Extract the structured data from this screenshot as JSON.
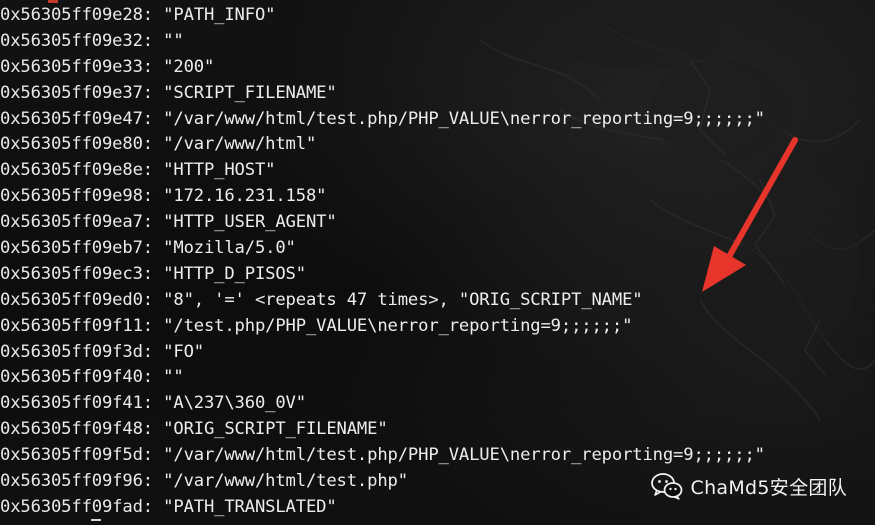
{
  "terminal": {
    "lines": [
      {
        "addr": "0x56305ff09e28:",
        "value": "\"PATH_INFO\""
      },
      {
        "addr": "0x56305ff09e32:",
        "value": "\"\""
      },
      {
        "addr": "0x56305ff09e33:",
        "value": "\"200\""
      },
      {
        "addr": "0x56305ff09e37:",
        "value": "\"SCRIPT_FILENAME\""
      },
      {
        "addr": "0x56305ff09e47:",
        "value": "\"/var/www/html/test.php/PHP_VALUE\\nerror_reporting=9;;;;;;\""
      },
      {
        "addr": "0x56305ff09e80:",
        "value": "\"/var/www/html\""
      },
      {
        "addr": "0x56305ff09e8e:",
        "value": "\"HTTP_HOST\""
      },
      {
        "addr": "0x56305ff09e98:",
        "value": "\"172.16.231.158\""
      },
      {
        "addr": "0x56305ff09ea7:",
        "value": "\"HTTP_USER_AGENT\""
      },
      {
        "addr": "0x56305ff09eb7:",
        "value": "\"Mozilla/5.0\""
      },
      {
        "addr": "0x56305ff09ec3:",
        "value": "\"HTTP_D_PISOS\""
      },
      {
        "addr": "0x56305ff09ed0:",
        "value": "\"8\", '=' <repeats 47 times>, \"ORIG_SCRIPT_NAME\""
      },
      {
        "addr": "0x56305ff09f11:",
        "value": "\"/test.php/PHP_VALUE\\nerror_reporting=9;;;;;;\""
      },
      {
        "addr": "0x56305ff09f3d:",
        "value": "\"FO\""
      },
      {
        "addr": "0x56305ff09f40:",
        "value": "\"\""
      },
      {
        "addr": "0x56305ff09f41:",
        "value": "\"A\\237\\360_0V\""
      },
      {
        "addr": "0x56305ff09f48:",
        "value": "\"ORIG_SCRIPT_FILENAME\""
      },
      {
        "addr": "0x56305ff09f5d:",
        "value": "\"/var/www/html/test.php/PHP_VALUE\\nerror_reporting=9;;;;;;\""
      },
      {
        "addr": "0x56305ff09f96:",
        "value": "\"/var/www/html/test.php\""
      },
      {
        "addr": "0x56305ff09fad:",
        "value": "\"PATH_TRANSLATED\""
      }
    ]
  },
  "annotation": {
    "arrow_color": "#e8352b",
    "arrow_icon": "red-arrow-icon"
  },
  "watermark": {
    "icon": "wechat-icon",
    "text": "ChaMd5安全团队"
  },
  "colors": {
    "background": "#0d0d0d",
    "text": "#e6e6e6",
    "arrow": "#e8352b"
  }
}
